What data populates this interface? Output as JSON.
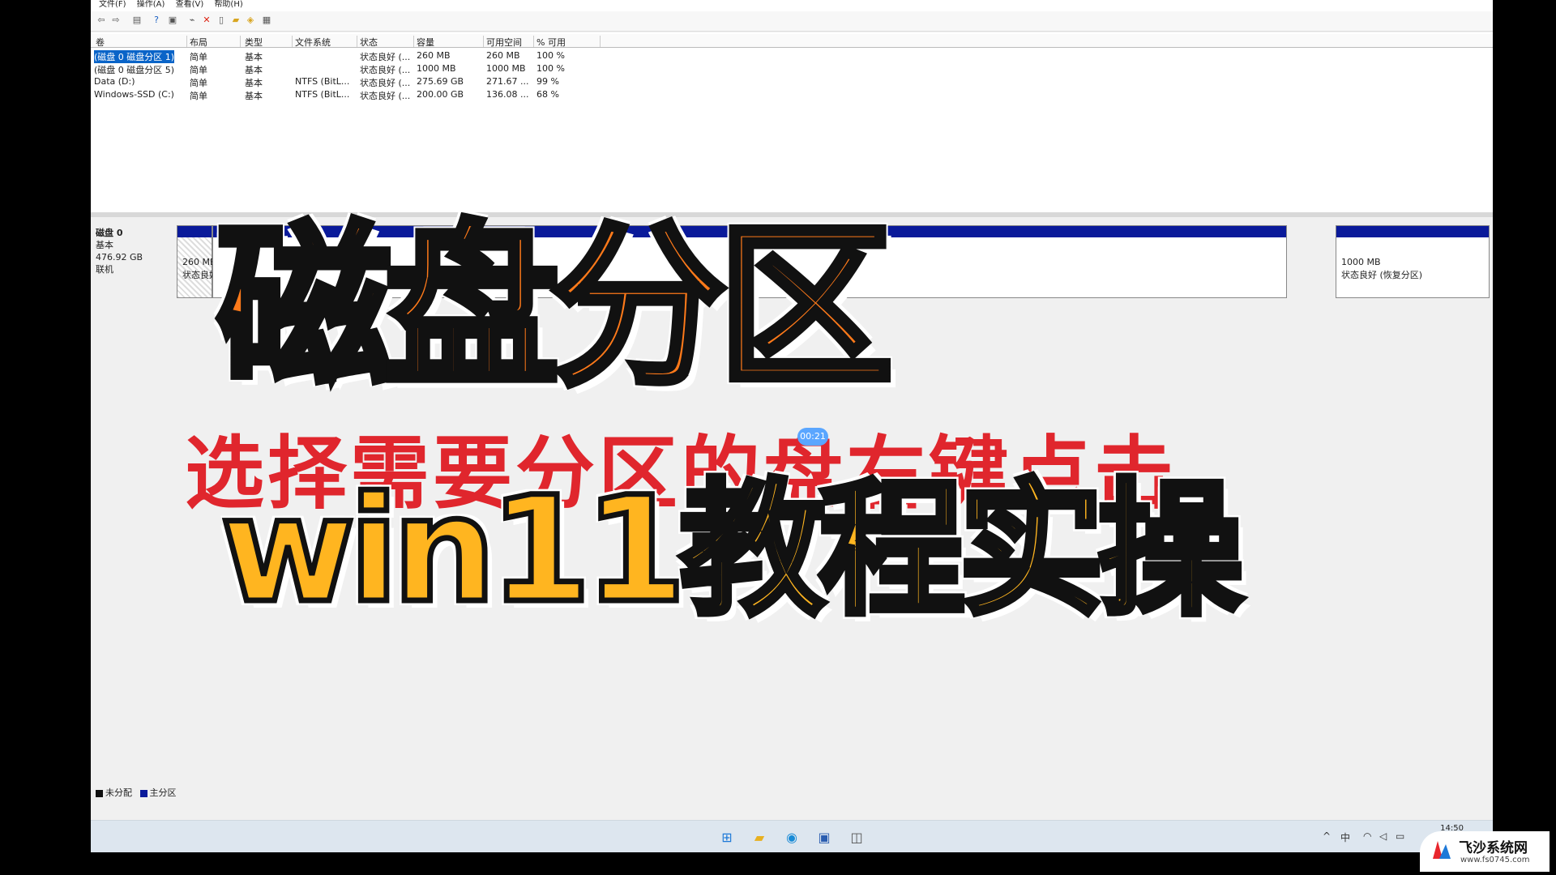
{
  "menu": [
    "文件(F)",
    "操作(A)",
    "查看(V)",
    "帮助(H)"
  ],
  "toolbar_icons": [
    "back-arrow-icon",
    "forward-arrow-icon",
    "disk-list-icon",
    "help-icon",
    "console-icon",
    "connect-icon",
    "delete-icon",
    "properties-icon",
    "folder-icon",
    "open-icon",
    "settings-icon"
  ],
  "volume_table": {
    "headers": [
      "卷",
      "布局",
      "类型",
      "文件系统",
      "状态",
      "容量",
      "可用空间",
      "% 可用"
    ],
    "rows": [
      [
        "(磁盘 0 磁盘分区 1)",
        "简单",
        "基本",
        "",
        "状态良好 (...",
        "260 MB",
        "260 MB",
        "100 %"
      ],
      [
        "(磁盘 0 磁盘分区 5)",
        "简单",
        "基本",
        "",
        "状态良好 (...",
        "1000 MB",
        "1000 MB",
        "100 %"
      ],
      [
        "Data (D:)",
        "简单",
        "基本",
        "NTFS (BitL...",
        "状态良好 (...",
        "275.69 GB",
        "271.67 ...",
        "99 %"
      ],
      [
        "Windows-SSD (C:)",
        "简单",
        "基本",
        "NTFS (BitL...",
        "状态良好 (...",
        "200.00 GB",
        "136.08 ...",
        "68 %"
      ]
    ]
  },
  "disk0": {
    "name": "磁盘 0",
    "type": "基本",
    "size": "476.92 GB",
    "status": "联机",
    "partitions": [
      {
        "size": "260 MB",
        "status": "状态良好"
      },
      {
        "size": "(D:",
        "status": ""
      },
      {
        "size": "1000 MB",
        "status": "状态良好 (恢复分区)"
      }
    ]
  },
  "legend": [
    {
      "label": "未分配",
      "color": "#111111"
    },
    {
      "label": "主分区",
      "color": "#0a1a9a"
    }
  ],
  "overlay": {
    "title": "磁盘分区",
    "subtitle": "win11教程实操",
    "instruction": "选择需要分区的盘右键点击",
    "timestamp": "00:21"
  },
  "taskbar": {
    "icons": [
      "windows-start-icon",
      "file-explorer-icon",
      "edge-browser-icon",
      "store-icon",
      "disk-management-icon"
    ],
    "tray": [
      "^",
      "中"
    ],
    "clock": "14:50"
  },
  "watermark": {
    "name": "飞沙系统网",
    "url": "www.fs0745.com"
  }
}
